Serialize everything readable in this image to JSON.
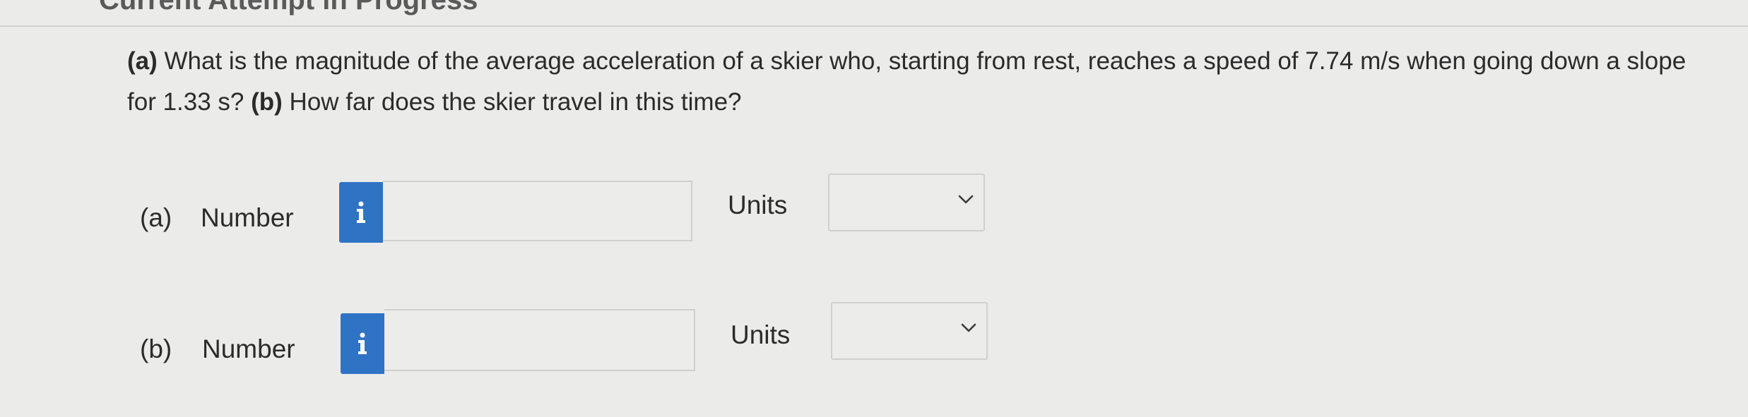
{
  "header": {
    "title": "Current Attempt in Progress"
  },
  "question": {
    "part_a_tag": "(a)",
    "part_a_text": " What is the magnitude of the average acceleration of a skier who, starting from rest, reaches a speed of 7.74 m/s when going down a slope for 1.33 s? ",
    "part_b_tag": "(b)",
    "part_b_text": " How far does the skier travel in this time?"
  },
  "answers": {
    "a": {
      "part_label": "(a)",
      "number_label": "Number",
      "number_value": "",
      "info_icon": "info-icon",
      "units_label": "Units",
      "units_value": "",
      "dropdown_icon": "chevron-down-icon"
    },
    "b": {
      "part_label": "(b)",
      "number_label": "Number",
      "number_value": "",
      "info_icon": "info-icon",
      "units_label": "Units",
      "units_value": "",
      "dropdown_icon": "chevron-down-icon"
    }
  },
  "colors": {
    "background": "#ebebea",
    "accent": "#2f73c4",
    "text": "#2b2b2b"
  }
}
